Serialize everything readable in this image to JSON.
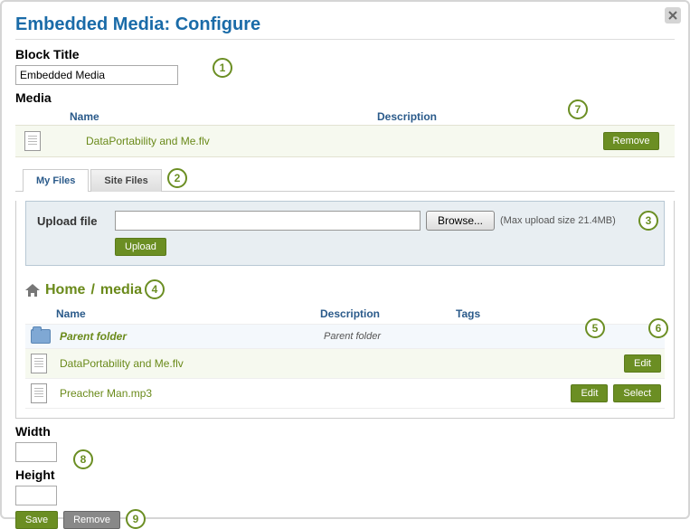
{
  "title": "Embedded Media: Configure",
  "block_title_label": "Block Title",
  "block_title_value": "Embedded Media",
  "media": {
    "heading": "Media",
    "cols": {
      "name": "Name",
      "desc": "Description"
    },
    "item": {
      "name": "DataPortability and Me.flv"
    },
    "remove_label": "Remove"
  },
  "tabs": {
    "my_files": "My Files",
    "site_files": "Site Files"
  },
  "upload": {
    "label": "Upload file",
    "browse": "Browse...",
    "hint": "(Max upload size 21.4MB)",
    "upload_btn": "Upload"
  },
  "breadcrumb": {
    "home": "Home",
    "sep": "/",
    "current": "media"
  },
  "file_table": {
    "cols": {
      "name": "Name",
      "desc": "Description",
      "tags": "Tags"
    },
    "rows": [
      {
        "name": "Parent folder",
        "desc": "Parent folder",
        "type": "folder",
        "parent": true
      },
      {
        "name": "DataPortability and Me.flv",
        "type": "file",
        "actions": [
          "Edit"
        ]
      },
      {
        "name": "Preacher Man.mp3",
        "type": "file",
        "actions": [
          "Edit",
          "Select"
        ]
      }
    ],
    "edit_label": "Edit",
    "select_label": "Select"
  },
  "width_label": "Width",
  "height_label": "Height",
  "save_label": "Save",
  "remove_label": "Remove",
  "callouts": {
    "1": "1",
    "2": "2",
    "3": "3",
    "4": "4",
    "5": "5",
    "6": "6",
    "7": "7",
    "8": "8",
    "9": "9"
  }
}
